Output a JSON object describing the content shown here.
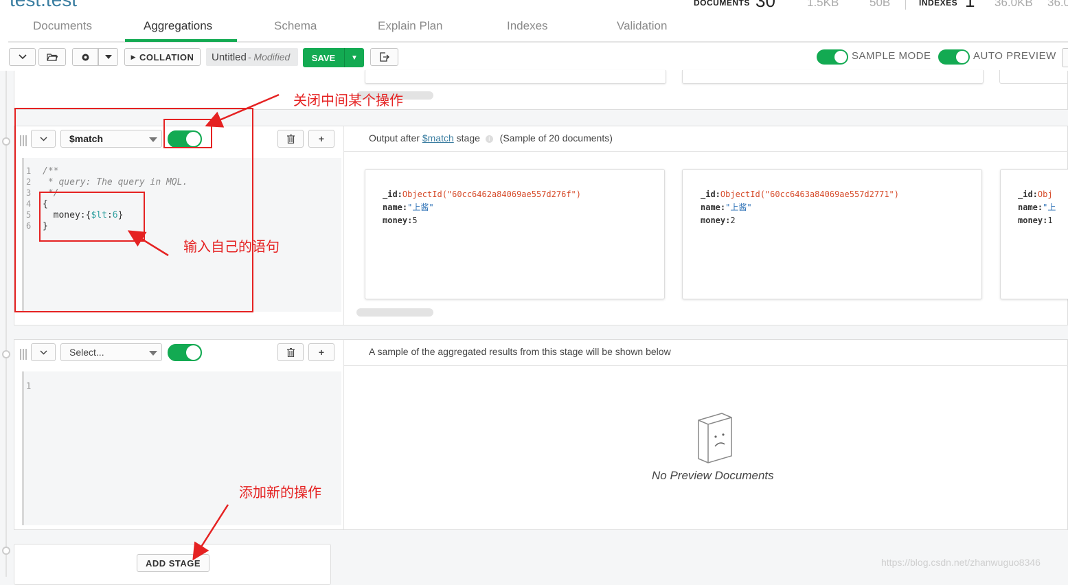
{
  "header": {
    "namespace": "test.test",
    "stats": {
      "documents_label": "DOCUMENTS",
      "documents_count": "30",
      "total_size": "1.5KB",
      "avg_size": "50B",
      "indexes_label": "INDEXES",
      "indexes_count": "1",
      "index_total_size": "36.0KB",
      "index_avg_size": "36.0"
    },
    "tabs": [
      {
        "label": "Documents"
      },
      {
        "label": "Aggregations"
      },
      {
        "label": "Schema"
      },
      {
        "label": "Explain Plan"
      },
      {
        "label": "Indexes"
      },
      {
        "label": "Validation"
      }
    ],
    "active_tab": "Aggregations"
  },
  "toolbar": {
    "collation_label": "COLLATION",
    "pipeline_name": "Untitled",
    "pipeline_modified": "- Modified",
    "save_label": "SAVE",
    "sample_mode_label": "SAMPLE MODE",
    "auto_preview_label": "AUTO PREVIEW",
    "sample_mode_on": true,
    "auto_preview_on": true
  },
  "stage1": {
    "operator": "$match",
    "enabled": true,
    "output_prefix": "Output after",
    "output_stage_link": "$match",
    "output_suffix": "stage",
    "sample_note": "(Sample of 20 documents)",
    "code_lines": [
      {
        "n": "1",
        "text": "/**"
      },
      {
        "n": "2",
        "text": " * query: The query in MQL."
      },
      {
        "n": "3",
        "text": " */"
      },
      {
        "n": "4",
        "text": "{"
      },
      {
        "n": "5",
        "text": "  money:{$lt:6}"
      },
      {
        "n": "6",
        "text": "}"
      }
    ],
    "documents": [
      {
        "id_key": "_id:",
        "id_value": "ObjectId(\"60cc6462a84069ae557d276f\")",
        "name_key": "name:",
        "name_value": "\"上酱\"",
        "money_key": "money:",
        "money_value": "5"
      },
      {
        "id_key": "_id:",
        "id_value": "ObjectId(\"60cc6463a84069ae557d2771\")",
        "name_key": "name:",
        "name_value": "\"上酱\"",
        "money_key": "money:",
        "money_value": "2"
      },
      {
        "id_key": "_id:",
        "id_value": "Obj",
        "name_key": "name:",
        "name_value": "\"上",
        "money_key": "money:",
        "money_value": "1"
      }
    ]
  },
  "stage2": {
    "operator_placeholder": "Select...",
    "enabled": true,
    "info": "A sample of the aggregated results from this stage will be shown below",
    "code_lines": [
      {
        "n": "1",
        "text": ""
      }
    ],
    "empty_text": "No Preview Documents"
  },
  "add_stage_label": "ADD STAGE",
  "annotations": {
    "toggle_note": "关闭中间某个操作",
    "query_note": "输入自己的语句",
    "add_note": "添加新的操作"
  },
  "watermark": "https://blog.csdn.net/zhanwuguo8346",
  "colors": {
    "accent_green": "#13aa52",
    "annotation_red": "#e52222",
    "link_blue": "#3b7ea1"
  }
}
